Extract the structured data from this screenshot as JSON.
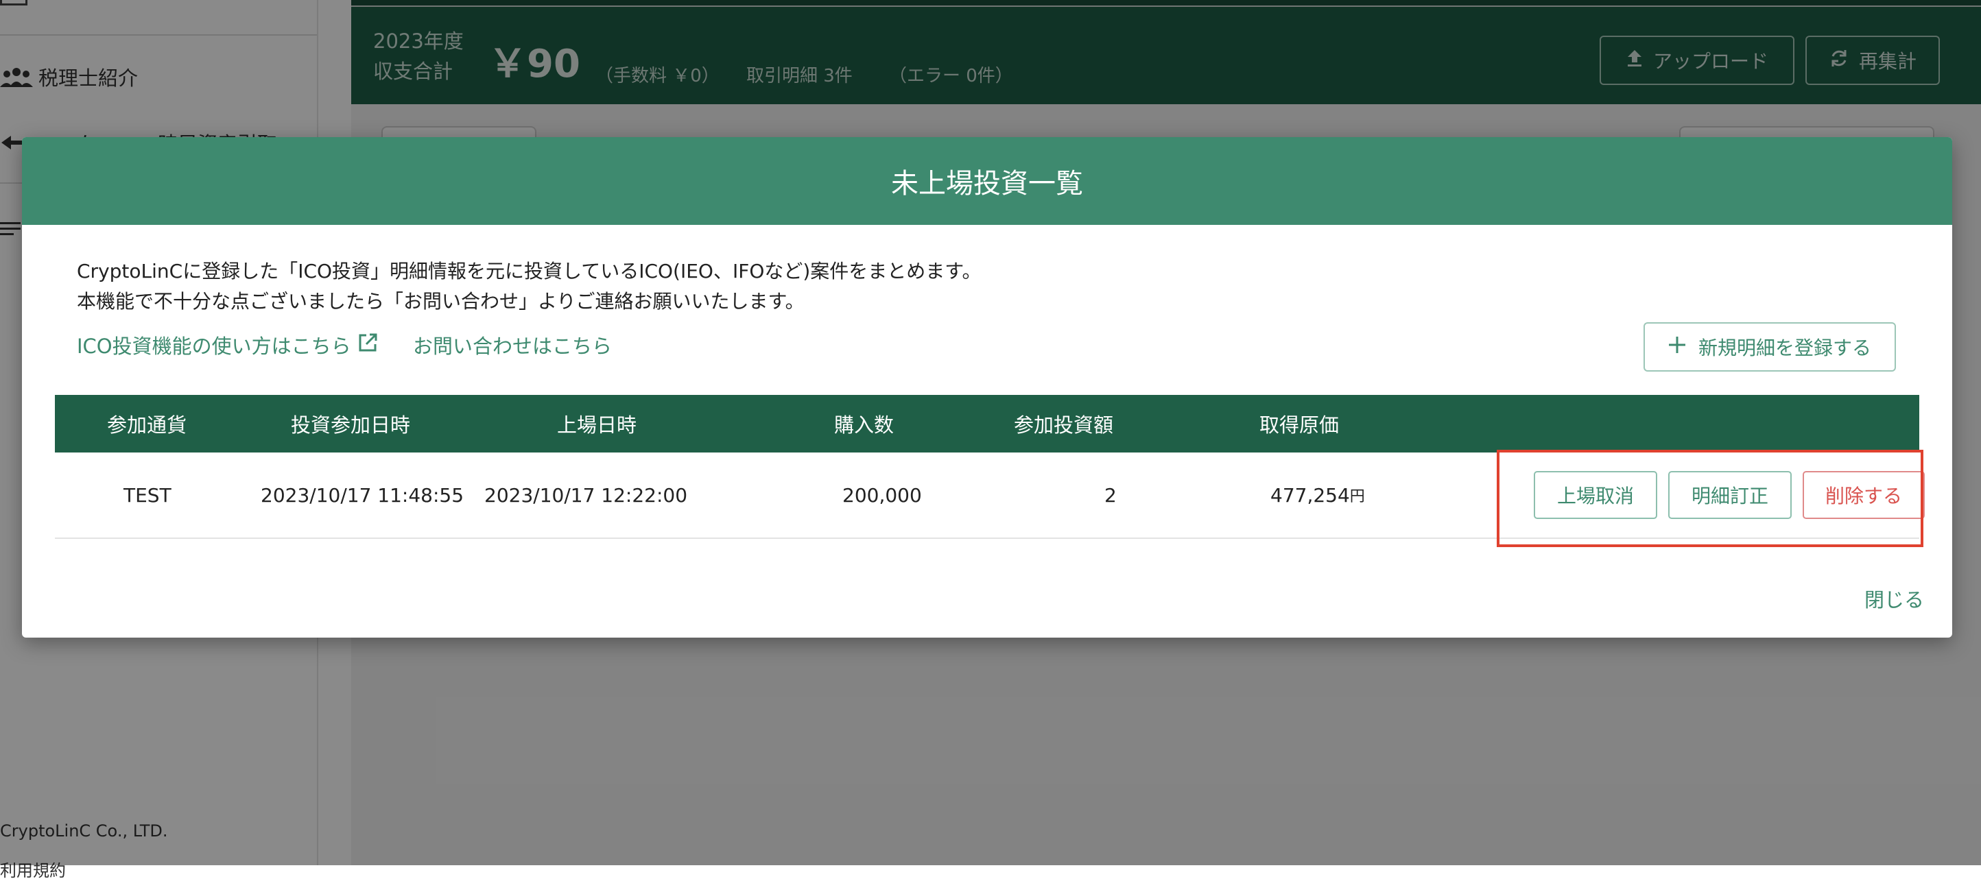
{
  "sidebar": {
    "items": [
      {
        "label": "税理士紹介",
        "icon": "people-icon"
      },
      {
        "label": "ー・ケッ・・時局資産引取",
        "icon": "arrow-icon"
      }
    ],
    "footer": {
      "company": "CryptoLinC Co., LTD.",
      "terms": "利用規約"
    }
  },
  "topbar": {
    "year_label": "2023年度",
    "total_label": "収支合計",
    "amount": "￥90",
    "fee": "（手数料 ￥0）",
    "transactions": "取引明細 3件",
    "errors": "（エラー 0件）",
    "upload_label": "アップロード",
    "recalc_label": "再集計"
  },
  "modal": {
    "title": "未上場投資一覧",
    "desc_line1": "CryptoLinCに登録した「ICO投資」明細情報を元に投資しているICO(IEO、IFOなど)案件をまとめます。",
    "desc_line2": "本機能で不十分な点ございましたら「お問い合わせ」よりご連絡お願いいたします。",
    "howto_link": "ICO投資機能の使い方はこちら",
    "contact_link": "お問い合わせはこちら",
    "new_button": "新規明細を登録する",
    "close_label": "閉じる"
  },
  "table": {
    "headers": [
      "参加通貨",
      "投資参加日時",
      "上場日時",
      "購入数",
      "参加投資額",
      "取得原価"
    ],
    "rows": [
      {
        "currency": "TEST",
        "invest_date": "2023/10/17 11:48:55",
        "listing_date": "2023/10/17 12:22:00",
        "quantity": "200,000",
        "amount": "2",
        "cost": "477,254",
        "cost_unit": "円",
        "actions": {
          "cancel_listing": "上場取消",
          "edit": "明細訂正",
          "delete": "削除する"
        }
      }
    ]
  },
  "colors": {
    "header_green": "#1f5f47",
    "modal_header": "#3e8a6f",
    "link_green": "#3e8a6f",
    "delete_red": "#d9534f",
    "highlight_red": "#e0422f"
  }
}
